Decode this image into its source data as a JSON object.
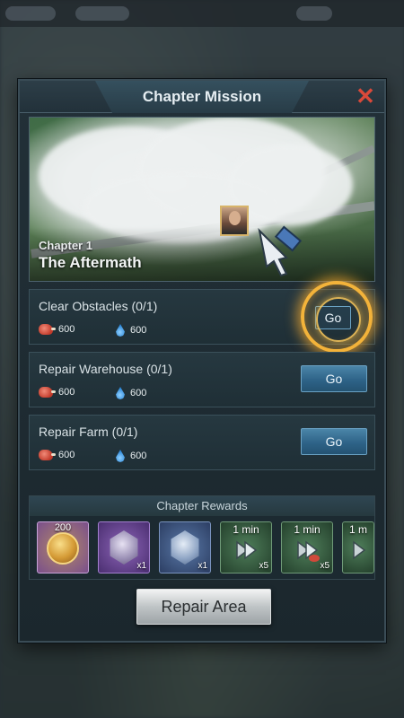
{
  "dialog": {
    "title": "Chapter Mission",
    "close_icon": "close-icon"
  },
  "banner": {
    "chapter_number": "Chapter 1",
    "chapter_name": "The Aftermath"
  },
  "missions": [
    {
      "label": "Clear Obstacles (0/1)",
      "meat": "600",
      "water": "600",
      "go_label": "Go",
      "highlighted": true
    },
    {
      "label": "Repair Warehouse (0/1)",
      "meat": "600",
      "water": "600",
      "go_label": "Go",
      "highlighted": false
    },
    {
      "label": "Repair Farm (0/1)",
      "meat": "600",
      "water": "600",
      "go_label": "Go",
      "highlighted": false
    }
  ],
  "rewards": {
    "header": "Chapter Rewards",
    "items": [
      {
        "icon": "gold-coin-icon",
        "count": "200",
        "style": "gold"
      },
      {
        "icon": "purple-medal-icon",
        "count": "x1",
        "style": "purple"
      },
      {
        "icon": "blue-medal-icon",
        "count": "x1",
        "style": "blue"
      },
      {
        "icon": "speedup-icon",
        "label": "1 min",
        "count": "x5",
        "style": "green"
      },
      {
        "icon": "food-speedup-icon",
        "label": "1 min",
        "count": "x5",
        "style": "green"
      },
      {
        "icon": "speedup-icon",
        "label": "1 m",
        "count": "",
        "style": "green"
      }
    ]
  },
  "repair_button_label": "Repair Area",
  "colors": {
    "accent_blue": "#2e6388",
    "highlight_ring": "#f3b33a",
    "close_red": "#d9493a"
  }
}
